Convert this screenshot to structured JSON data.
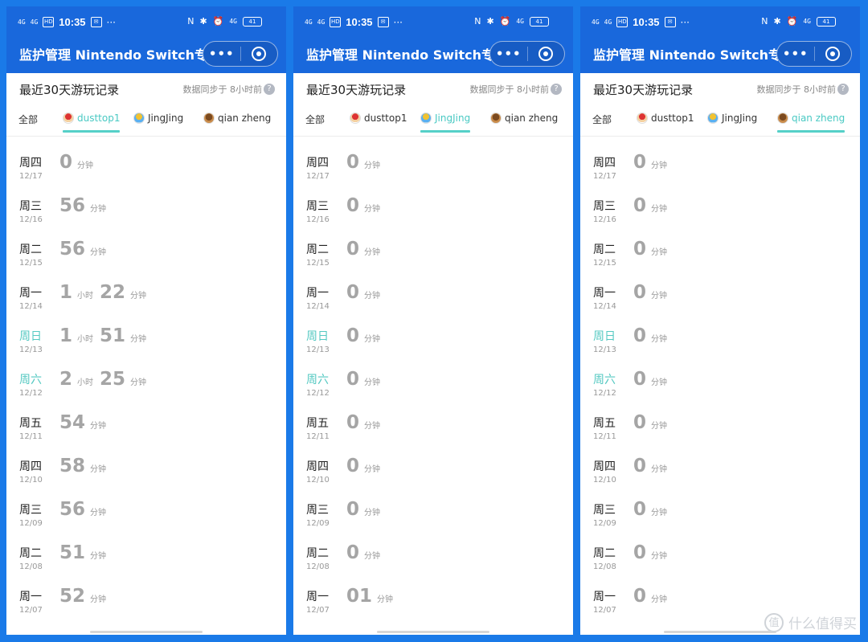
{
  "status_bar": {
    "time": "10:35",
    "network": "4G",
    "hd": "HD",
    "battery": "41"
  },
  "header": {
    "title": "监护管理 Nintendo Switch专用",
    "more_glyph": "•••"
  },
  "subheader": {
    "heading": "最近30天游玩记录",
    "sync": "数据同步于 8小时前",
    "help_glyph": "?"
  },
  "tabs": {
    "all": "全部",
    "dusttop1": "dusttop1",
    "jingjing": "JingJing",
    "qianzheng": "qian zheng"
  },
  "units": {
    "hour": "小时",
    "minute": "分钟"
  },
  "days": [
    {
      "day": "周四",
      "date": "12/17",
      "weekend": false
    },
    {
      "day": "周三",
      "date": "12/16",
      "weekend": false
    },
    {
      "day": "周二",
      "date": "12/15",
      "weekend": false
    },
    {
      "day": "周一",
      "date": "12/14",
      "weekend": false
    },
    {
      "day": "周日",
      "date": "12/13",
      "weekend": true
    },
    {
      "day": "周六",
      "date": "12/12",
      "weekend": true
    },
    {
      "day": "周五",
      "date": "12/11",
      "weekend": false
    },
    {
      "day": "周四",
      "date": "12/10",
      "weekend": false
    },
    {
      "day": "周三",
      "date": "12/09",
      "weekend": false
    },
    {
      "day": "周二",
      "date": "12/08",
      "weekend": false
    },
    {
      "day": "周一",
      "date": "12/07",
      "weekend": false
    }
  ],
  "panels": [
    {
      "active_tab": "dusttop1",
      "records": [
        {
          "minutes": "0"
        },
        {
          "minutes": "56"
        },
        {
          "minutes": "56"
        },
        {
          "hours": "1",
          "minutes": "22"
        },
        {
          "hours": "1",
          "minutes": "51"
        },
        {
          "hours": "2",
          "minutes": "25"
        },
        {
          "minutes": "54"
        },
        {
          "minutes": "58"
        },
        {
          "minutes": "56"
        },
        {
          "minutes": "51"
        },
        {
          "minutes": "52"
        }
      ]
    },
    {
      "active_tab": "jingjing",
      "records": [
        {
          "minutes": "0"
        },
        {
          "minutes": "0"
        },
        {
          "minutes": "0"
        },
        {
          "minutes": "0"
        },
        {
          "minutes": "0"
        },
        {
          "minutes": "0"
        },
        {
          "minutes": "0"
        },
        {
          "minutes": "0"
        },
        {
          "minutes": "0"
        },
        {
          "minutes": "0"
        },
        {
          "minutes": "01"
        }
      ]
    },
    {
      "active_tab": "qianzheng",
      "records": [
        {
          "minutes": "0"
        },
        {
          "minutes": "0"
        },
        {
          "minutes": "0"
        },
        {
          "minutes": "0"
        },
        {
          "minutes": "0"
        },
        {
          "minutes": "0"
        },
        {
          "minutes": "0"
        },
        {
          "minutes": "0"
        },
        {
          "minutes": "0"
        },
        {
          "minutes": "0"
        },
        {
          "minutes": "0"
        }
      ]
    }
  ],
  "watermark": {
    "icon_glyph": "值",
    "text": "什么值得买"
  },
  "colors": {
    "header_bg": "#1968dc",
    "accent": "#49c9c3",
    "page_bg": "#1a7ae8"
  }
}
